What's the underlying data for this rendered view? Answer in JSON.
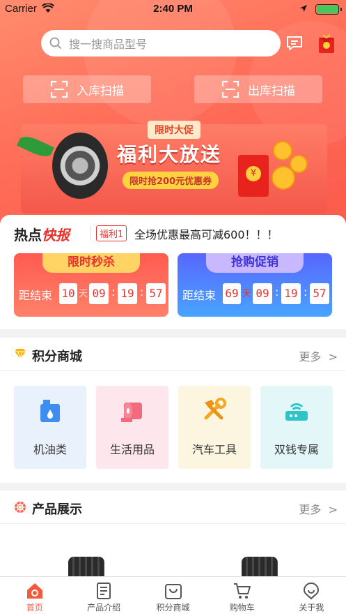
{
  "status_bar": {
    "carrier": "Carrier",
    "time": "2:40 PM"
  },
  "search": {
    "placeholder": "搜一搜商品型号"
  },
  "scan": {
    "in_label": "入库扫描",
    "out_label": "出库扫描"
  },
  "banner": {
    "tag": "限时大促",
    "title": "福利大放送",
    "subtitle": "限时抢200元优惠券",
    "bag_symbol": "¥"
  },
  "news": {
    "label_plain": "热点",
    "label_emph": "快报",
    "badge": "福利1",
    "text": "全场优惠最高可减600！！！"
  },
  "promos": [
    {
      "title": "限时秒杀",
      "ends_label": "距结束",
      "days": "10",
      "day_unit": "天",
      "hours": "09",
      "minutes": "19",
      "seconds": "57"
    },
    {
      "title": "抢购促销",
      "ends_label": "距结束",
      "days": "69",
      "day_unit": "天",
      "hours": "09",
      "minutes": "19",
      "seconds": "57"
    }
  ],
  "points_mall": {
    "title": "积分商城",
    "more": "更多",
    "categories": [
      {
        "label": "机油类",
        "icon": "oil-can-icon"
      },
      {
        "label": "生活用品",
        "icon": "tissue-roll-icon"
      },
      {
        "label": "汽车工具",
        "icon": "tools-icon"
      },
      {
        "label": "双钱专属",
        "icon": "router-icon"
      }
    ]
  },
  "products": {
    "title": "产品展示",
    "more": "更多"
  },
  "tabbar": [
    {
      "label": "首页",
      "active": true
    },
    {
      "label": "产品介绍",
      "active": false
    },
    {
      "label": "积分商城",
      "active": false
    },
    {
      "label": "购物车",
      "active": false
    },
    {
      "label": "关于我",
      "active": false
    }
  ],
  "colors": {
    "brand": "#f25b3c",
    "header": "#ff6e58",
    "promo_red": "#ff5b4f",
    "promo_blue": "#5866ff"
  }
}
